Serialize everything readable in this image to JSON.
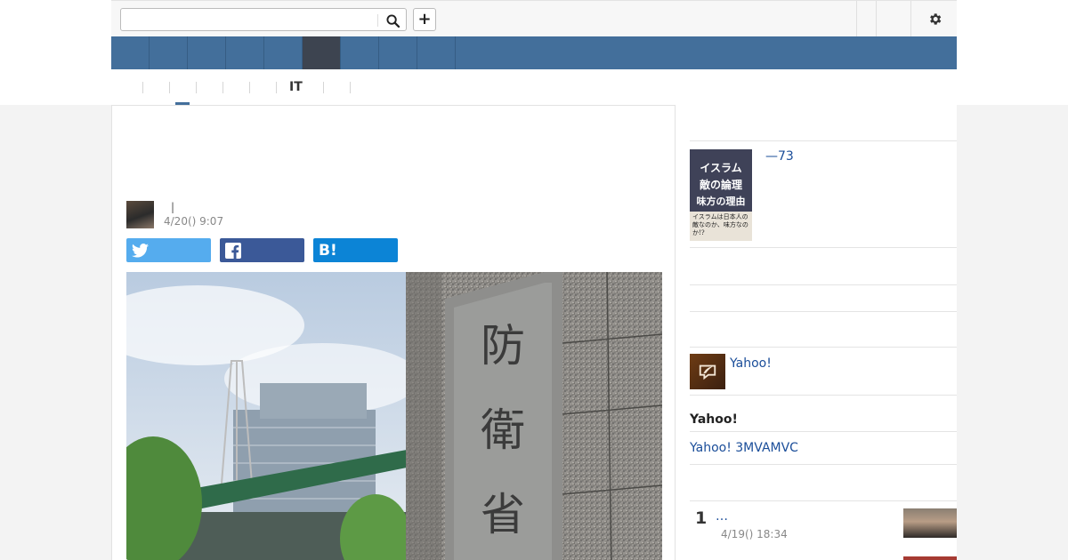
{
  "header": {
    "search_placeholder": "",
    "search_value": "",
    "plus_label": "+"
  },
  "subnav": {
    "it_label": "IT"
  },
  "article": {
    "title": "",
    "author_separator": "|",
    "date": "4/20() 9:07",
    "share_buttons": {
      "hatena_label": "B!"
    },
    "photo_text": "防衛省"
  },
  "sidebar": {
    "book_link": "—73",
    "book_cover_lines": [
      "イスラム",
      "敵の論理",
      "味方の理由"
    ],
    "book_cover_small": "イスラムは日本人の敵なのか、味方なのか!?",
    "notice_link": "Yahoo!",
    "section_heading": "Yahoo!",
    "promo_link": "Yahoo! 3MVAMVC",
    "ranking": [
      {
        "rank": "1",
        "title": "…",
        "date": "4/19() 18:34"
      }
    ]
  },
  "colors": {
    "nav_blue": "#436f9b",
    "nav_active": "#3d4450",
    "twitter": "#55acee",
    "facebook": "#3b5998",
    "hatena": "#0c84d6",
    "link": "#1a4d99"
  }
}
